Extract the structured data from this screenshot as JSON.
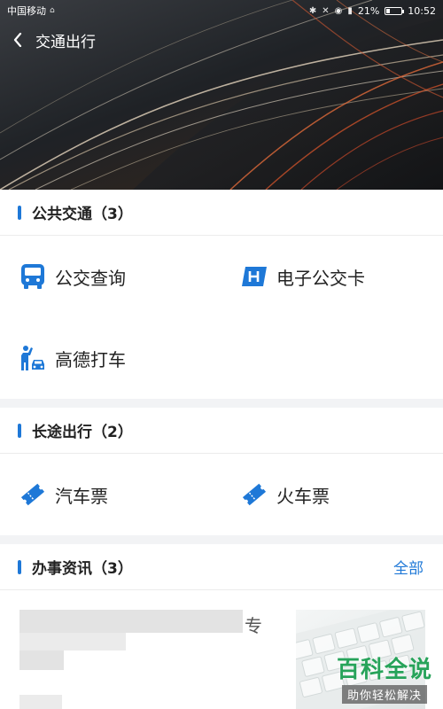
{
  "status_bar": {
    "carrier": "中国移动",
    "battery_text": "21%",
    "battery_level": 0.21,
    "time": "10:52",
    "icons": [
      "sim-icon",
      "bluetooth-icon",
      "mute-icon",
      "eye-icon",
      "signal-icon",
      "battery-icon"
    ]
  },
  "header": {
    "title": "交通出行",
    "back_icon": "chevron-left-icon"
  },
  "sections": {
    "public": {
      "title": "公共交通（3）",
      "items": [
        {
          "label": "公交查询",
          "icon": "bus-icon",
          "color": "#1e78d7"
        },
        {
          "label": "电子公交卡",
          "icon": "h-card-icon",
          "color": "#1e78d7"
        },
        {
          "label": "高德打车",
          "icon": "taxi-person-icon",
          "color": "#1e78d7"
        }
      ]
    },
    "long": {
      "title": "长途出行（2）",
      "items": [
        {
          "label": "汽车票",
          "icon": "ticket-icon",
          "color": "#1e78d7"
        },
        {
          "label": "火车票",
          "icon": "ticket-icon",
          "color": "#1e78d7"
        }
      ]
    },
    "news": {
      "title": "办事资讯（3）",
      "more_label": "全部",
      "partial_char": "专"
    }
  },
  "watermark": {
    "logo": "百科全说",
    "sub": "助你轻松解决"
  },
  "colors": {
    "accent": "#1e78d7",
    "watermark_green": "#27a35a",
    "background": "#f2f3f5"
  }
}
